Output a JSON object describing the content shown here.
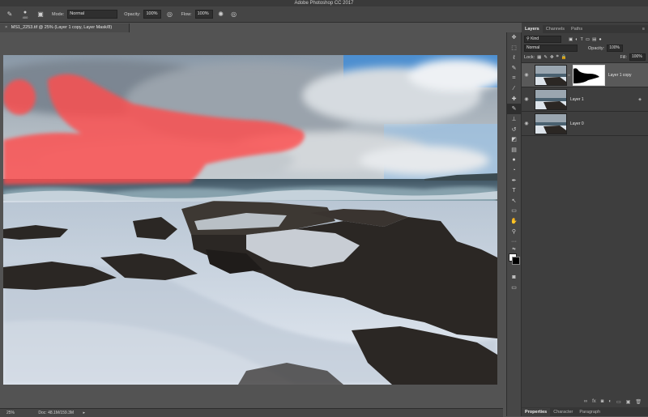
{
  "app_title": "Adobe Photoshop CC 2017",
  "options_bar": {
    "brush_size": "400",
    "mode_label": "Mode:",
    "mode_value": "Normal",
    "opacity_label": "Opacity:",
    "opacity_value": "100%",
    "flow_label": "Flow:",
    "flow_value": "100%"
  },
  "document_tab": {
    "title": "MS1_2253.tif @ 25% (Layer 1 copy, Layer Mask/8)",
    "close": "×"
  },
  "status_bar": {
    "zoom": "25%",
    "doc_info": "Doc: 48.1M/159.3M"
  },
  "tools": [
    {
      "name": "move-tool",
      "glyph": "✥"
    },
    {
      "name": "marquee-tool",
      "glyph": "⬚"
    },
    {
      "name": "lasso-tool",
      "glyph": "ℓ"
    },
    {
      "name": "quick-select-tool",
      "glyph": "✎"
    },
    {
      "name": "crop-tool",
      "glyph": "⌗"
    },
    {
      "name": "eyedropper-tool",
      "glyph": "⁄"
    },
    {
      "name": "healing-brush-tool",
      "glyph": "✚"
    },
    {
      "name": "brush-tool",
      "glyph": "✎"
    },
    {
      "name": "clone-stamp-tool",
      "glyph": "⊥"
    },
    {
      "name": "history-brush-tool",
      "glyph": "↺"
    },
    {
      "name": "eraser-tool",
      "glyph": "◩"
    },
    {
      "name": "gradient-tool",
      "glyph": "▤"
    },
    {
      "name": "blur-tool",
      "glyph": "●"
    },
    {
      "name": "dodge-tool",
      "glyph": "◔"
    },
    {
      "name": "pen-tool",
      "glyph": "✒"
    },
    {
      "name": "type-tool",
      "glyph": "T"
    },
    {
      "name": "path-select-tool",
      "glyph": "↖"
    },
    {
      "name": "shape-tool",
      "glyph": "▭"
    },
    {
      "name": "hand-tool",
      "glyph": "✋"
    },
    {
      "name": "zoom-tool",
      "glyph": "⚲"
    },
    {
      "name": "more-tools",
      "glyph": "···"
    }
  ],
  "panels": {
    "tabs": [
      "Layers",
      "Channels",
      "Paths"
    ],
    "kind_label": "Kind",
    "blend_mode": "Normal",
    "opacity_label": "Opacity:",
    "opacity_value": "100%",
    "lock_label": "Lock:",
    "fill_label": "Fill:",
    "fill_value": "100%",
    "layers": [
      {
        "name": "Layer 1 copy",
        "selected": true,
        "has_mask": true
      },
      {
        "name": "Layer 1",
        "selected": false,
        "has_mask": false
      },
      {
        "name": "Layer 0",
        "selected": false,
        "has_mask": false
      }
    ],
    "bottom_tabs": [
      "Properties",
      "Character",
      "Paragraph"
    ]
  },
  "colors": {
    "mask_overlay": "#ff4d4d",
    "selected_layer": "#595959",
    "panel_bg": "#3e3e3e"
  }
}
